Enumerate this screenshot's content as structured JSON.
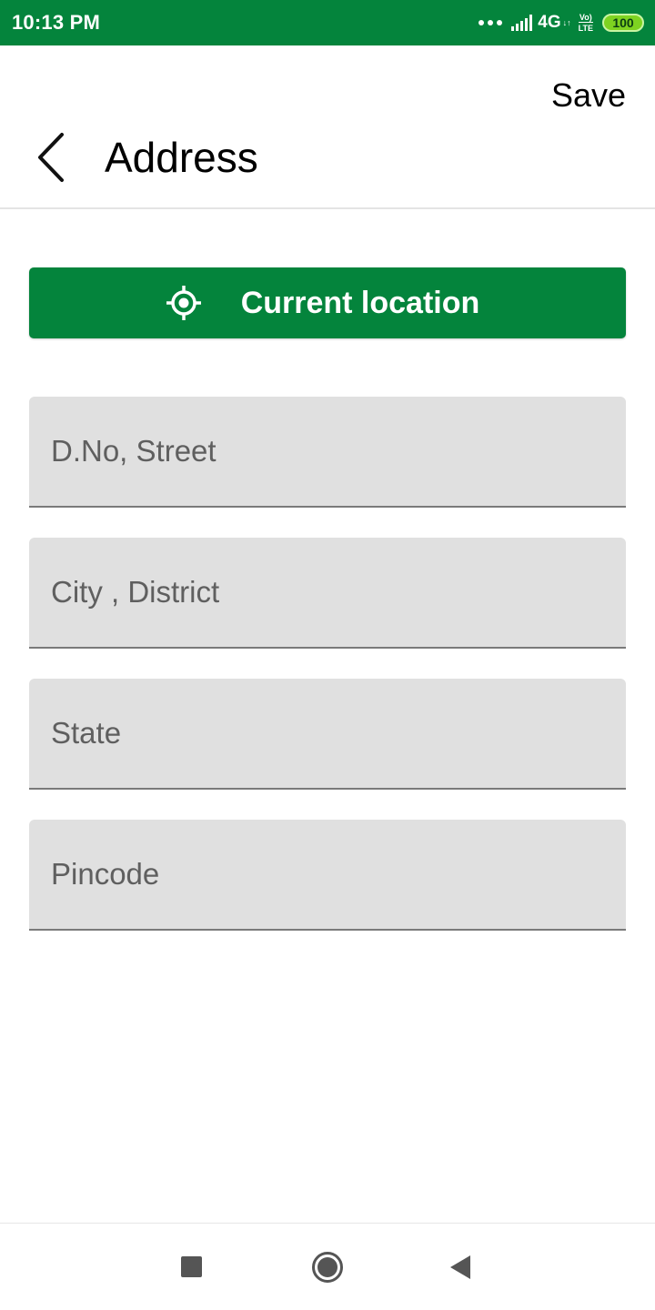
{
  "status_bar": {
    "time": "10:13 PM",
    "network": "4G",
    "network_arrows": "↓↑",
    "volte_top": "Vo)",
    "volte_bottom": "LTE",
    "battery": "100"
  },
  "header": {
    "title": "Address",
    "save_label": "Save",
    "back_icon": "chevron-left-icon"
  },
  "location_button": {
    "label": "Current location",
    "icon": "gps-target-icon"
  },
  "form": {
    "fields": [
      {
        "placeholder": "D.No, Street",
        "value": ""
      },
      {
        "placeholder": "City , District",
        "value": ""
      },
      {
        "placeholder": "State",
        "value": ""
      },
      {
        "placeholder": "Pincode",
        "value": ""
      }
    ]
  },
  "nav_bar": {
    "recent_icon": "square-icon",
    "home_icon": "circle-icon",
    "back_icon": "triangle-left-icon"
  },
  "colors": {
    "primary": "#04843c",
    "field_bg": "#e0e0e0",
    "placeholder": "#5f5f5f"
  }
}
